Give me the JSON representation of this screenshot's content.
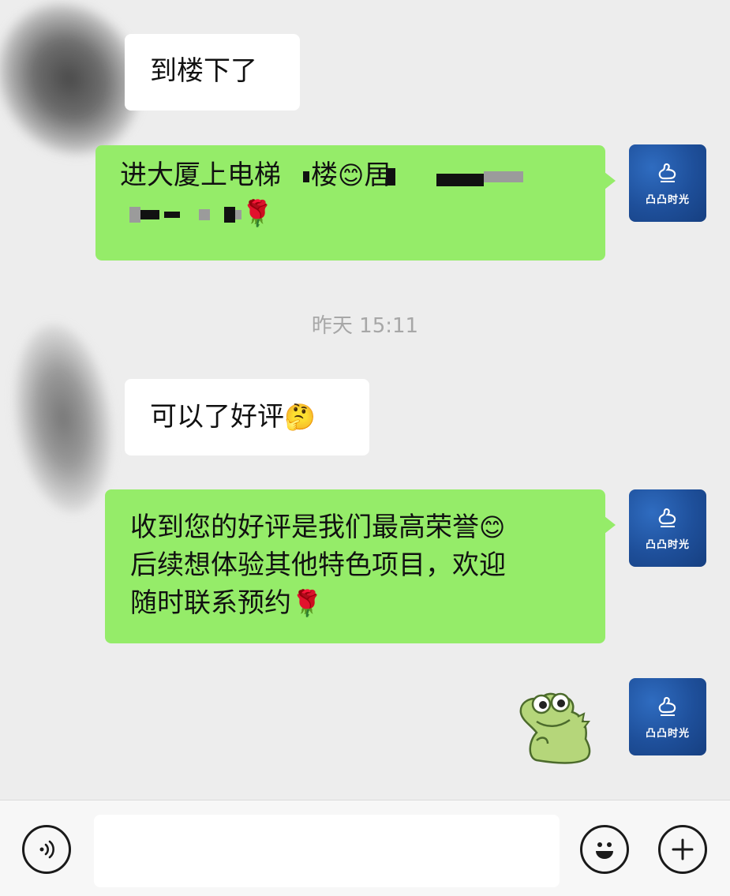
{
  "colors": {
    "background": "#ededed",
    "bubble_self": "#95ec69",
    "bubble_other": "#ffffff",
    "avatar_brand": "#1e4f9a",
    "timestamp": "#a7a7a7"
  },
  "brand_avatar": {
    "name": "凸凸时光"
  },
  "messages": [
    {
      "sender": "other",
      "text": "到楼下了"
    },
    {
      "sender": "self",
      "line1_a": "进大厦上电梯",
      "line1_b": "楼",
      "emoji1": "😊",
      "line1_c": "居",
      "emoji2": "🌹"
    },
    {
      "sender": "other",
      "text": "可以了好评",
      "emoji": "🤔"
    },
    {
      "sender": "self",
      "line1": "收到您的好评是我们最高荣誉",
      "emoji1": "😊",
      "line2": "后续想体验其他特色项目，欢迎",
      "line3": "随时联系预约",
      "emoji2": "🌹"
    },
    {
      "sender": "self",
      "type": "sticker",
      "sticker": "frog-sticker"
    }
  ],
  "timestamp": "昨天 15:11",
  "input_bar": {
    "voice_icon": "voice-icon",
    "emoji_icon": "smiley-icon",
    "plus_icon": "plus-icon",
    "text_value": ""
  }
}
